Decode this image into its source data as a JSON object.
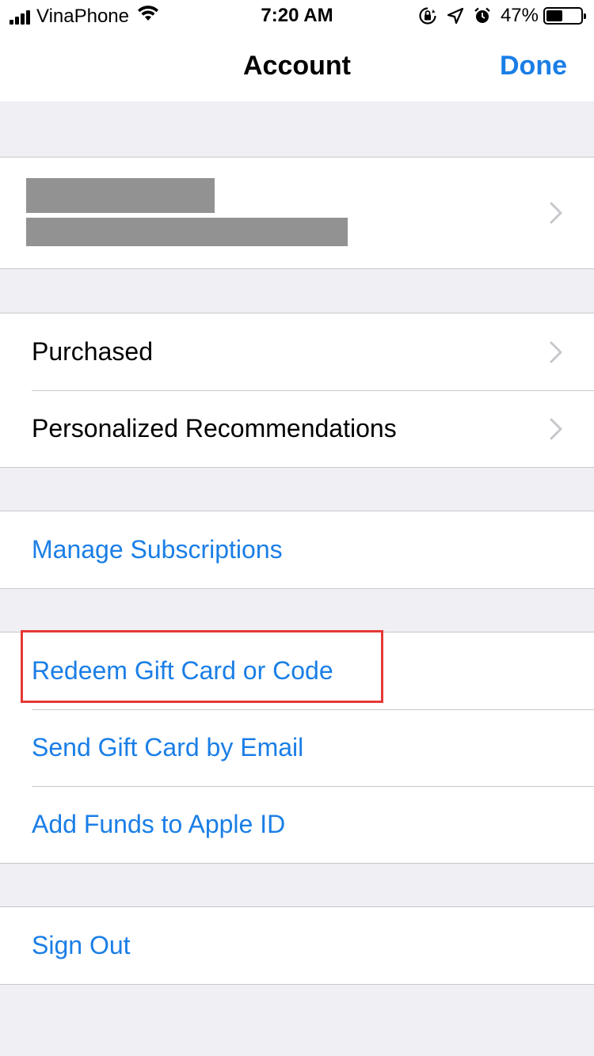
{
  "status_bar": {
    "carrier": "VinaPhone",
    "time": "7:20 AM",
    "battery_percent_label": "47%",
    "battery_level": 0.47,
    "icons": [
      "signal-icon",
      "wifi-icon",
      "orientation-lock-icon",
      "location-icon",
      "alarm-icon",
      "battery-icon"
    ]
  },
  "nav": {
    "title": "Account",
    "done_label": "Done"
  },
  "account": {
    "name_redacted": true,
    "email_redacted": true
  },
  "groups": {
    "purchases": [
      {
        "label": "Purchased"
      },
      {
        "label": "Personalized Recommendations"
      }
    ],
    "subscriptions": [
      {
        "label": "Manage Subscriptions"
      }
    ],
    "gift_cards": [
      {
        "label": "Redeem Gift Card or Code"
      },
      {
        "label": "Send Gift Card by Email"
      },
      {
        "label": "Add Funds to Apple ID"
      }
    ],
    "sign_out": [
      {
        "label": "Sign Out"
      }
    ]
  },
  "colors": {
    "link": "#1a7ee6",
    "background": "#efeff4",
    "separator": "#c8c7cc",
    "highlight": "#e53935",
    "redaction": "#929292"
  }
}
